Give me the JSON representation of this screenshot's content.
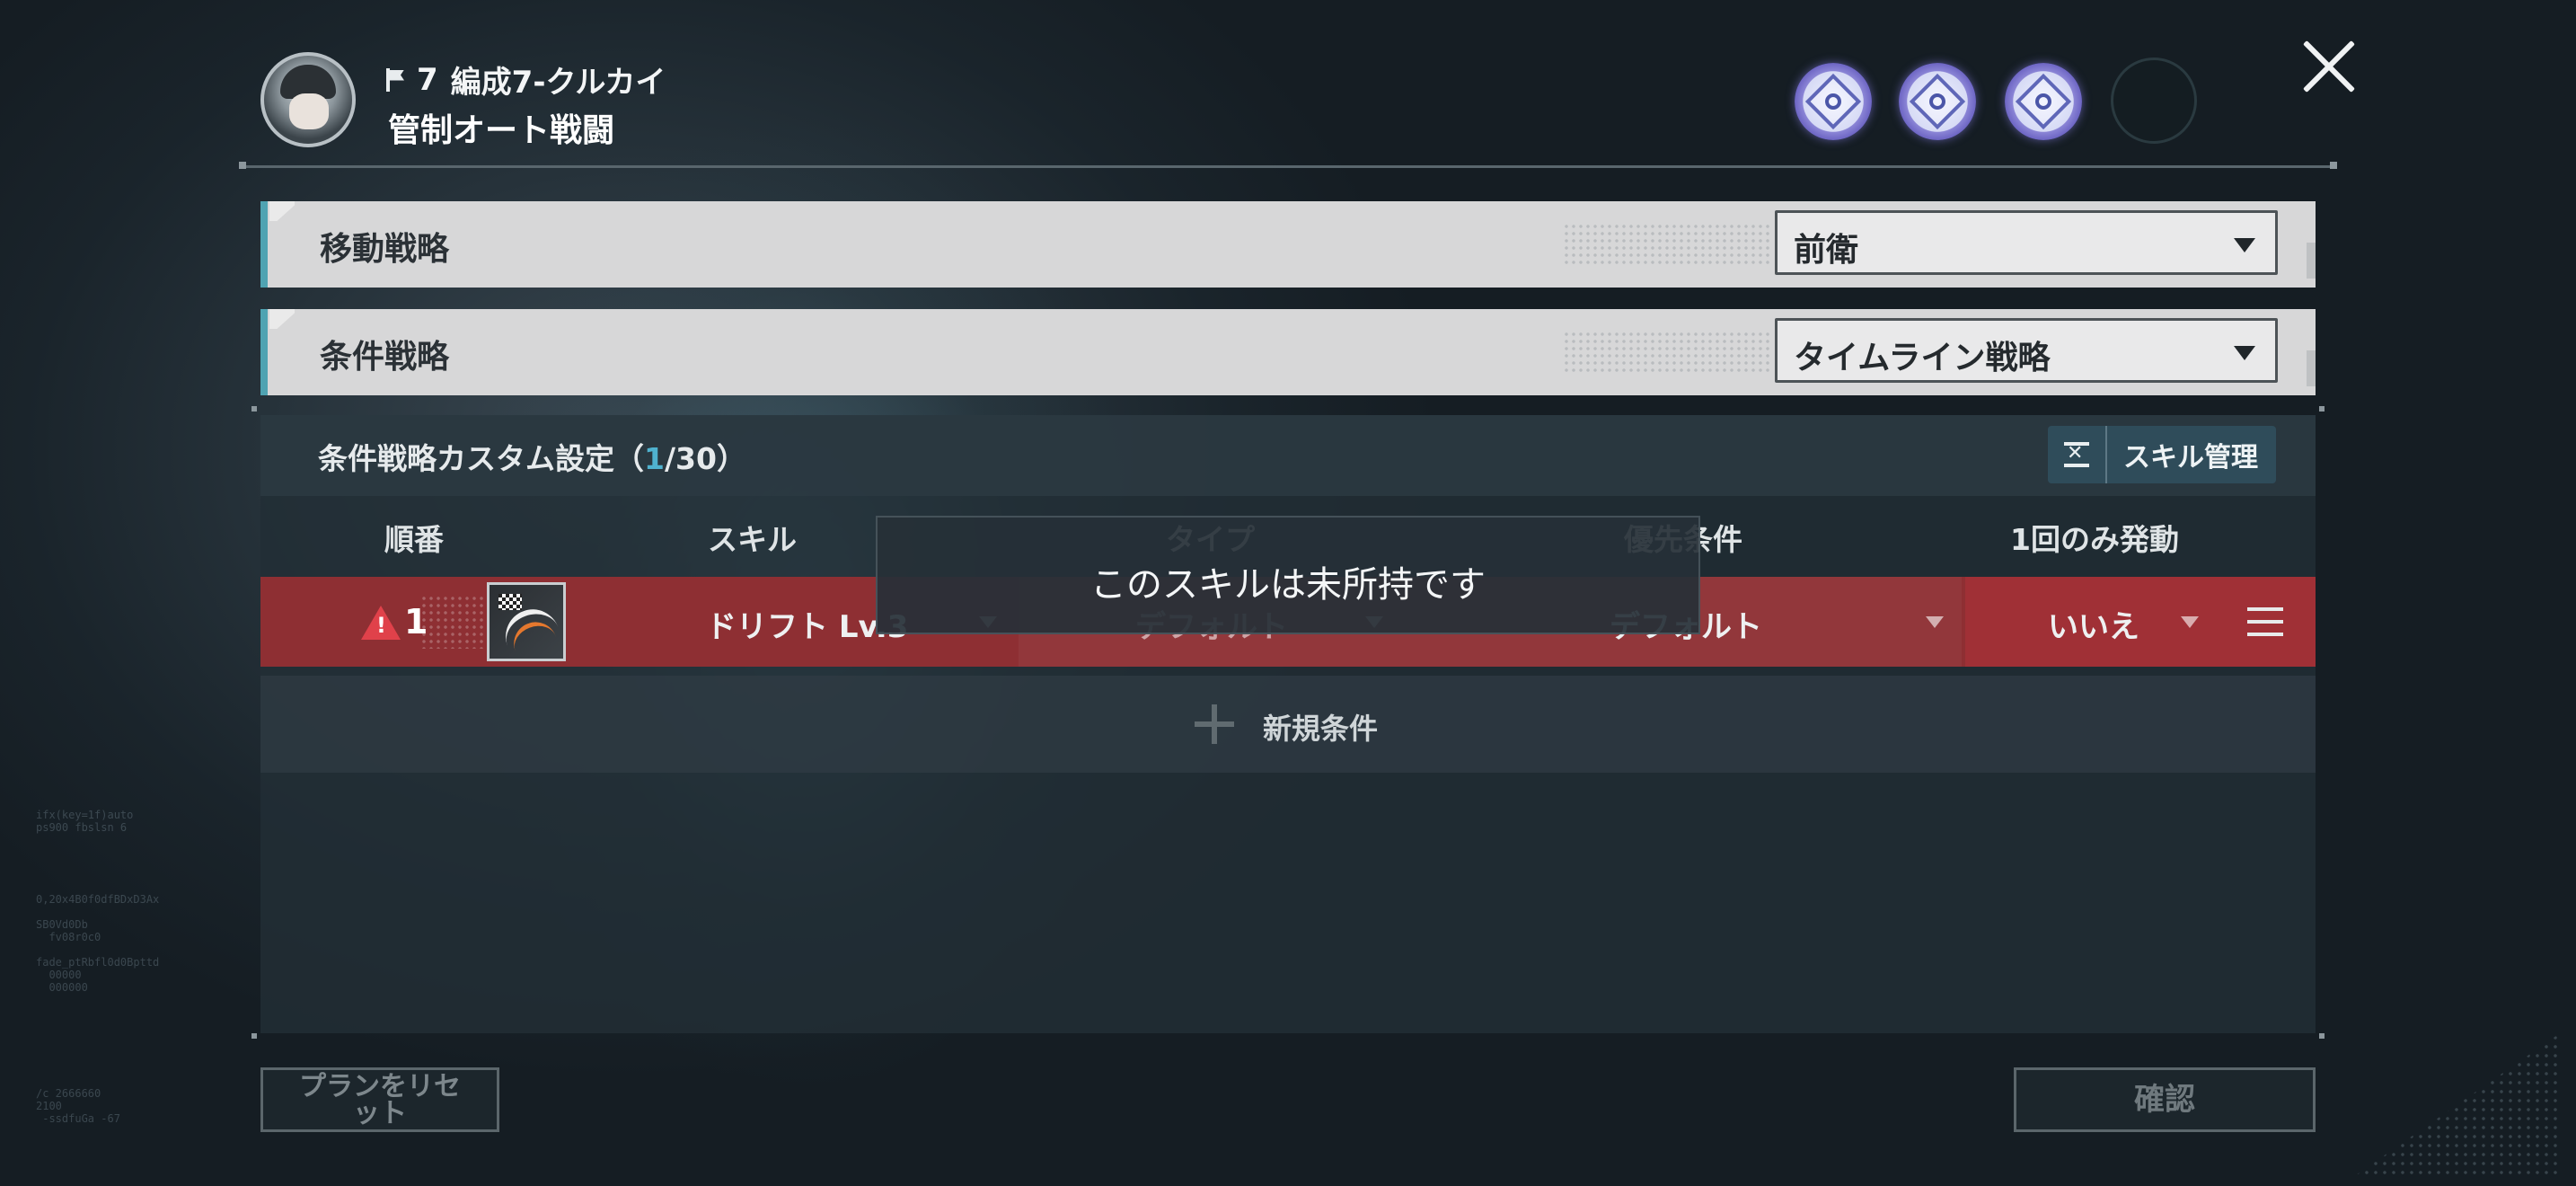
{
  "header": {
    "team_number": "7",
    "team_name": "編成7-クルカイ",
    "mode_title": "管制オート戦闘"
  },
  "move_strategy": {
    "label": "移動戦略",
    "value": "前衛"
  },
  "condition_strategy": {
    "label": "条件戦略",
    "value": "タイムライン戦略"
  },
  "custom": {
    "title_prefix": "条件戦略カスタム設定（",
    "count_current": "1",
    "count_rest": "/30）",
    "skill_mgmt_label": "スキル管理"
  },
  "columns": {
    "order": "順番",
    "skill": "スキル",
    "type": "タイプ",
    "priority": "優先条件",
    "once": "1回のみ発動"
  },
  "row": {
    "order": "1",
    "skill": "ドリフト Lv.3",
    "type": "デフォルト",
    "priority": "デフォルト",
    "once": "いいえ"
  },
  "new_condition_label": "新規条件",
  "toast_message": "このスキルは未所持です",
  "buttons": {
    "reset": "プランをリセット",
    "confirm": "確認"
  },
  "colors": {
    "accent": "#4fb2cf",
    "row_warning": "#8e2f33",
    "warn_icon": "#e0414a"
  }
}
